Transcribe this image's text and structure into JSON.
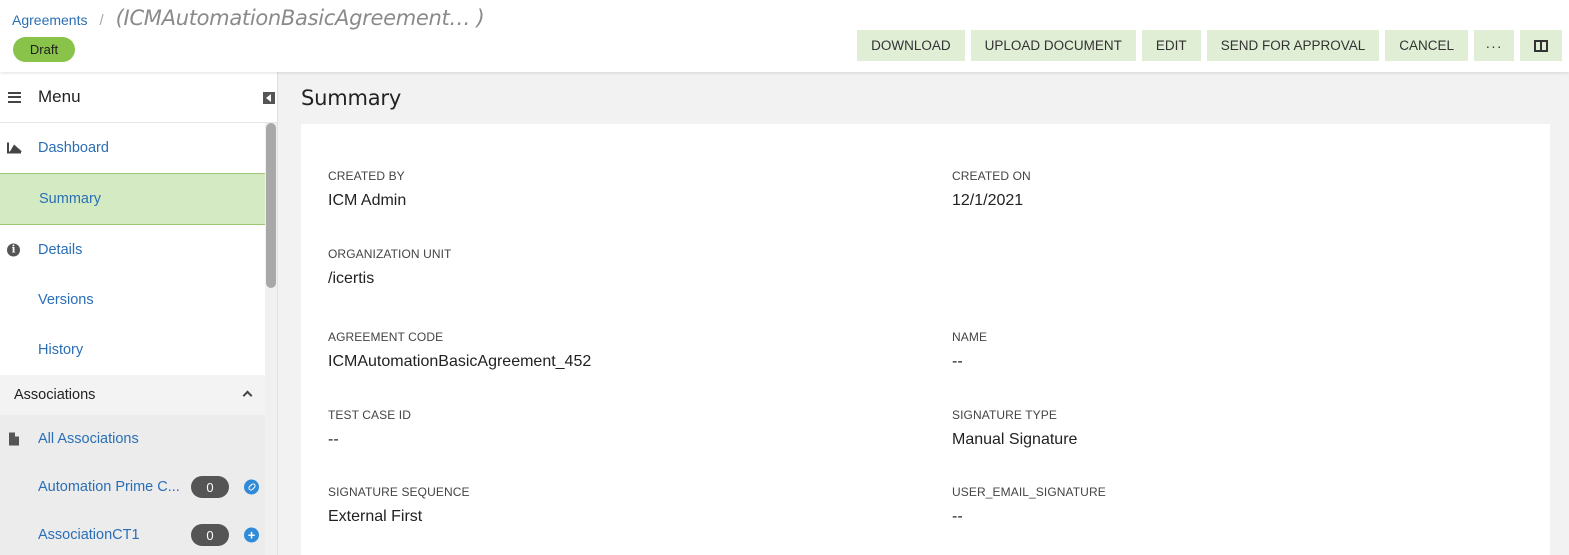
{
  "header": {
    "breadcrumb_link": "Agreements",
    "breadcrumb_separator": "/",
    "record_title": "(ICMAutomationBasicAgreement… )",
    "status_badge": "Draft",
    "actions": {
      "download": "DOWNLOAD",
      "upload_document": "UPLOAD DOCUMENT",
      "edit": "EDIT",
      "send_for_approval": "SEND FOR APPROVAL",
      "cancel": "CANCEL",
      "more": "···"
    },
    "accent_color": "#dfeed4",
    "badge_color": "#8ac34a"
  },
  "sidebar": {
    "menu_title": "Menu",
    "items": [
      {
        "label": "Dashboard",
        "icon": "chart-icon"
      },
      {
        "label": "Summary",
        "icon": "",
        "active": true
      },
      {
        "label": "Details",
        "icon": "info-icon"
      },
      {
        "label": "Versions",
        "icon": ""
      },
      {
        "label": "History",
        "icon": ""
      }
    ],
    "associations": {
      "title": "Associations",
      "items": [
        {
          "label": "All Associations",
          "icon": "document-icon"
        },
        {
          "label": "Automation Prime C...",
          "count": "0",
          "action_icon": "link-icon"
        },
        {
          "label": "AssociationCT1",
          "count": "0",
          "action_icon": "plus-icon"
        }
      ]
    }
  },
  "main": {
    "title": "Summary",
    "fields": {
      "created_by": {
        "label": "CREATED BY",
        "value": "ICM Admin"
      },
      "created_on": {
        "label": "CREATED ON",
        "value": "12/1/2021"
      },
      "organization_unit": {
        "label": "ORGANIZATION UNIT",
        "value": "/icertis"
      },
      "agreement_code": {
        "label": "AGREEMENT CODE",
        "value": "ICMAutomationBasicAgreement_452"
      },
      "name": {
        "label": "NAME",
        "value": "--"
      },
      "test_case_id": {
        "label": "TEST CASE ID",
        "value": "--"
      },
      "signature_type": {
        "label": "SIGNATURE TYPE",
        "value": "Manual Signature"
      },
      "signature_sequence": {
        "label": "SIGNATURE SEQUENCE",
        "value": "External First"
      },
      "user_email_signature": {
        "label": "USER_EMAIL_SIGNATURE",
        "value": "--"
      }
    }
  }
}
